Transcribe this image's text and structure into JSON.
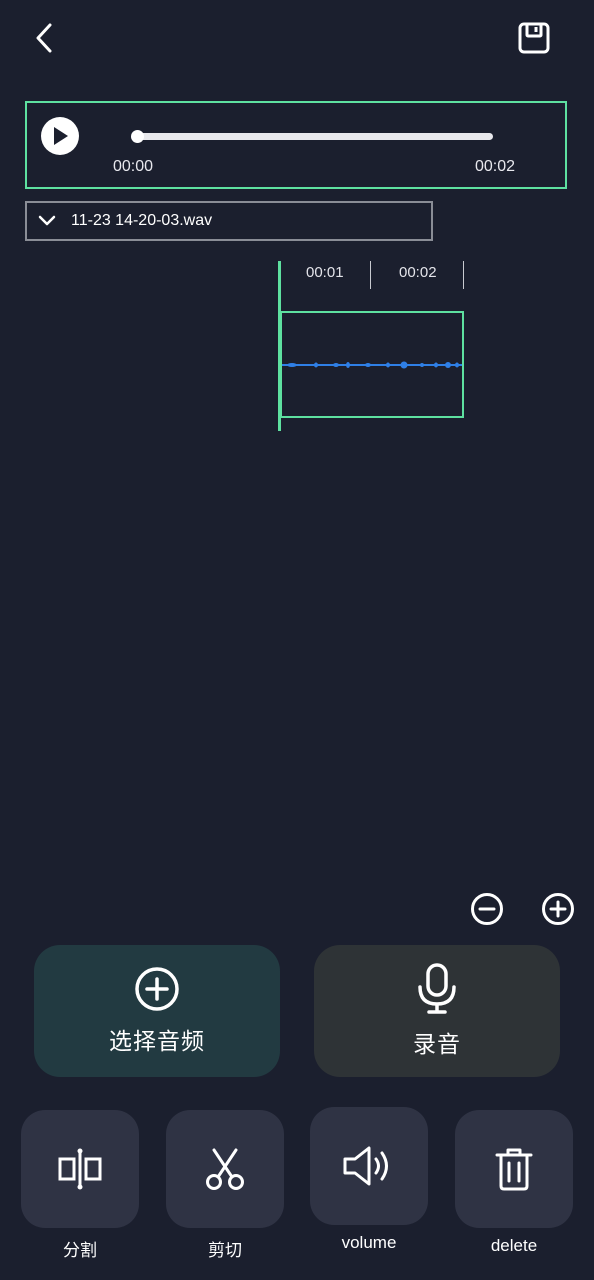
{
  "topbar": {
    "back_icon": "chevron-left-icon",
    "save_icon": "floppy-save-icon"
  },
  "player": {
    "state_icon": "play-icon",
    "progress": 0,
    "time_start": "00:00",
    "time_end": "00:02"
  },
  "file_select": {
    "selected": "11-23 14-20-03.wav",
    "icon": "chevron-down-icon"
  },
  "timeline": {
    "ticks": [
      "00:01",
      "00:02"
    ]
  },
  "zoom": {
    "out_icon": "zoom-out-icon",
    "in_icon": "zoom-in-icon"
  },
  "actions": {
    "select_audio_label": "选择音频",
    "record_label": "录音"
  },
  "tools": {
    "split_label": "分割",
    "cut_label": "剪切",
    "volume_label": "volume",
    "delete_label": "delete"
  },
  "colors": {
    "background": "#1b1f2e",
    "accent_green": "#5ee0a0",
    "waveform_blue": "#2f7fe6",
    "tool_bg": "#2f3344"
  }
}
